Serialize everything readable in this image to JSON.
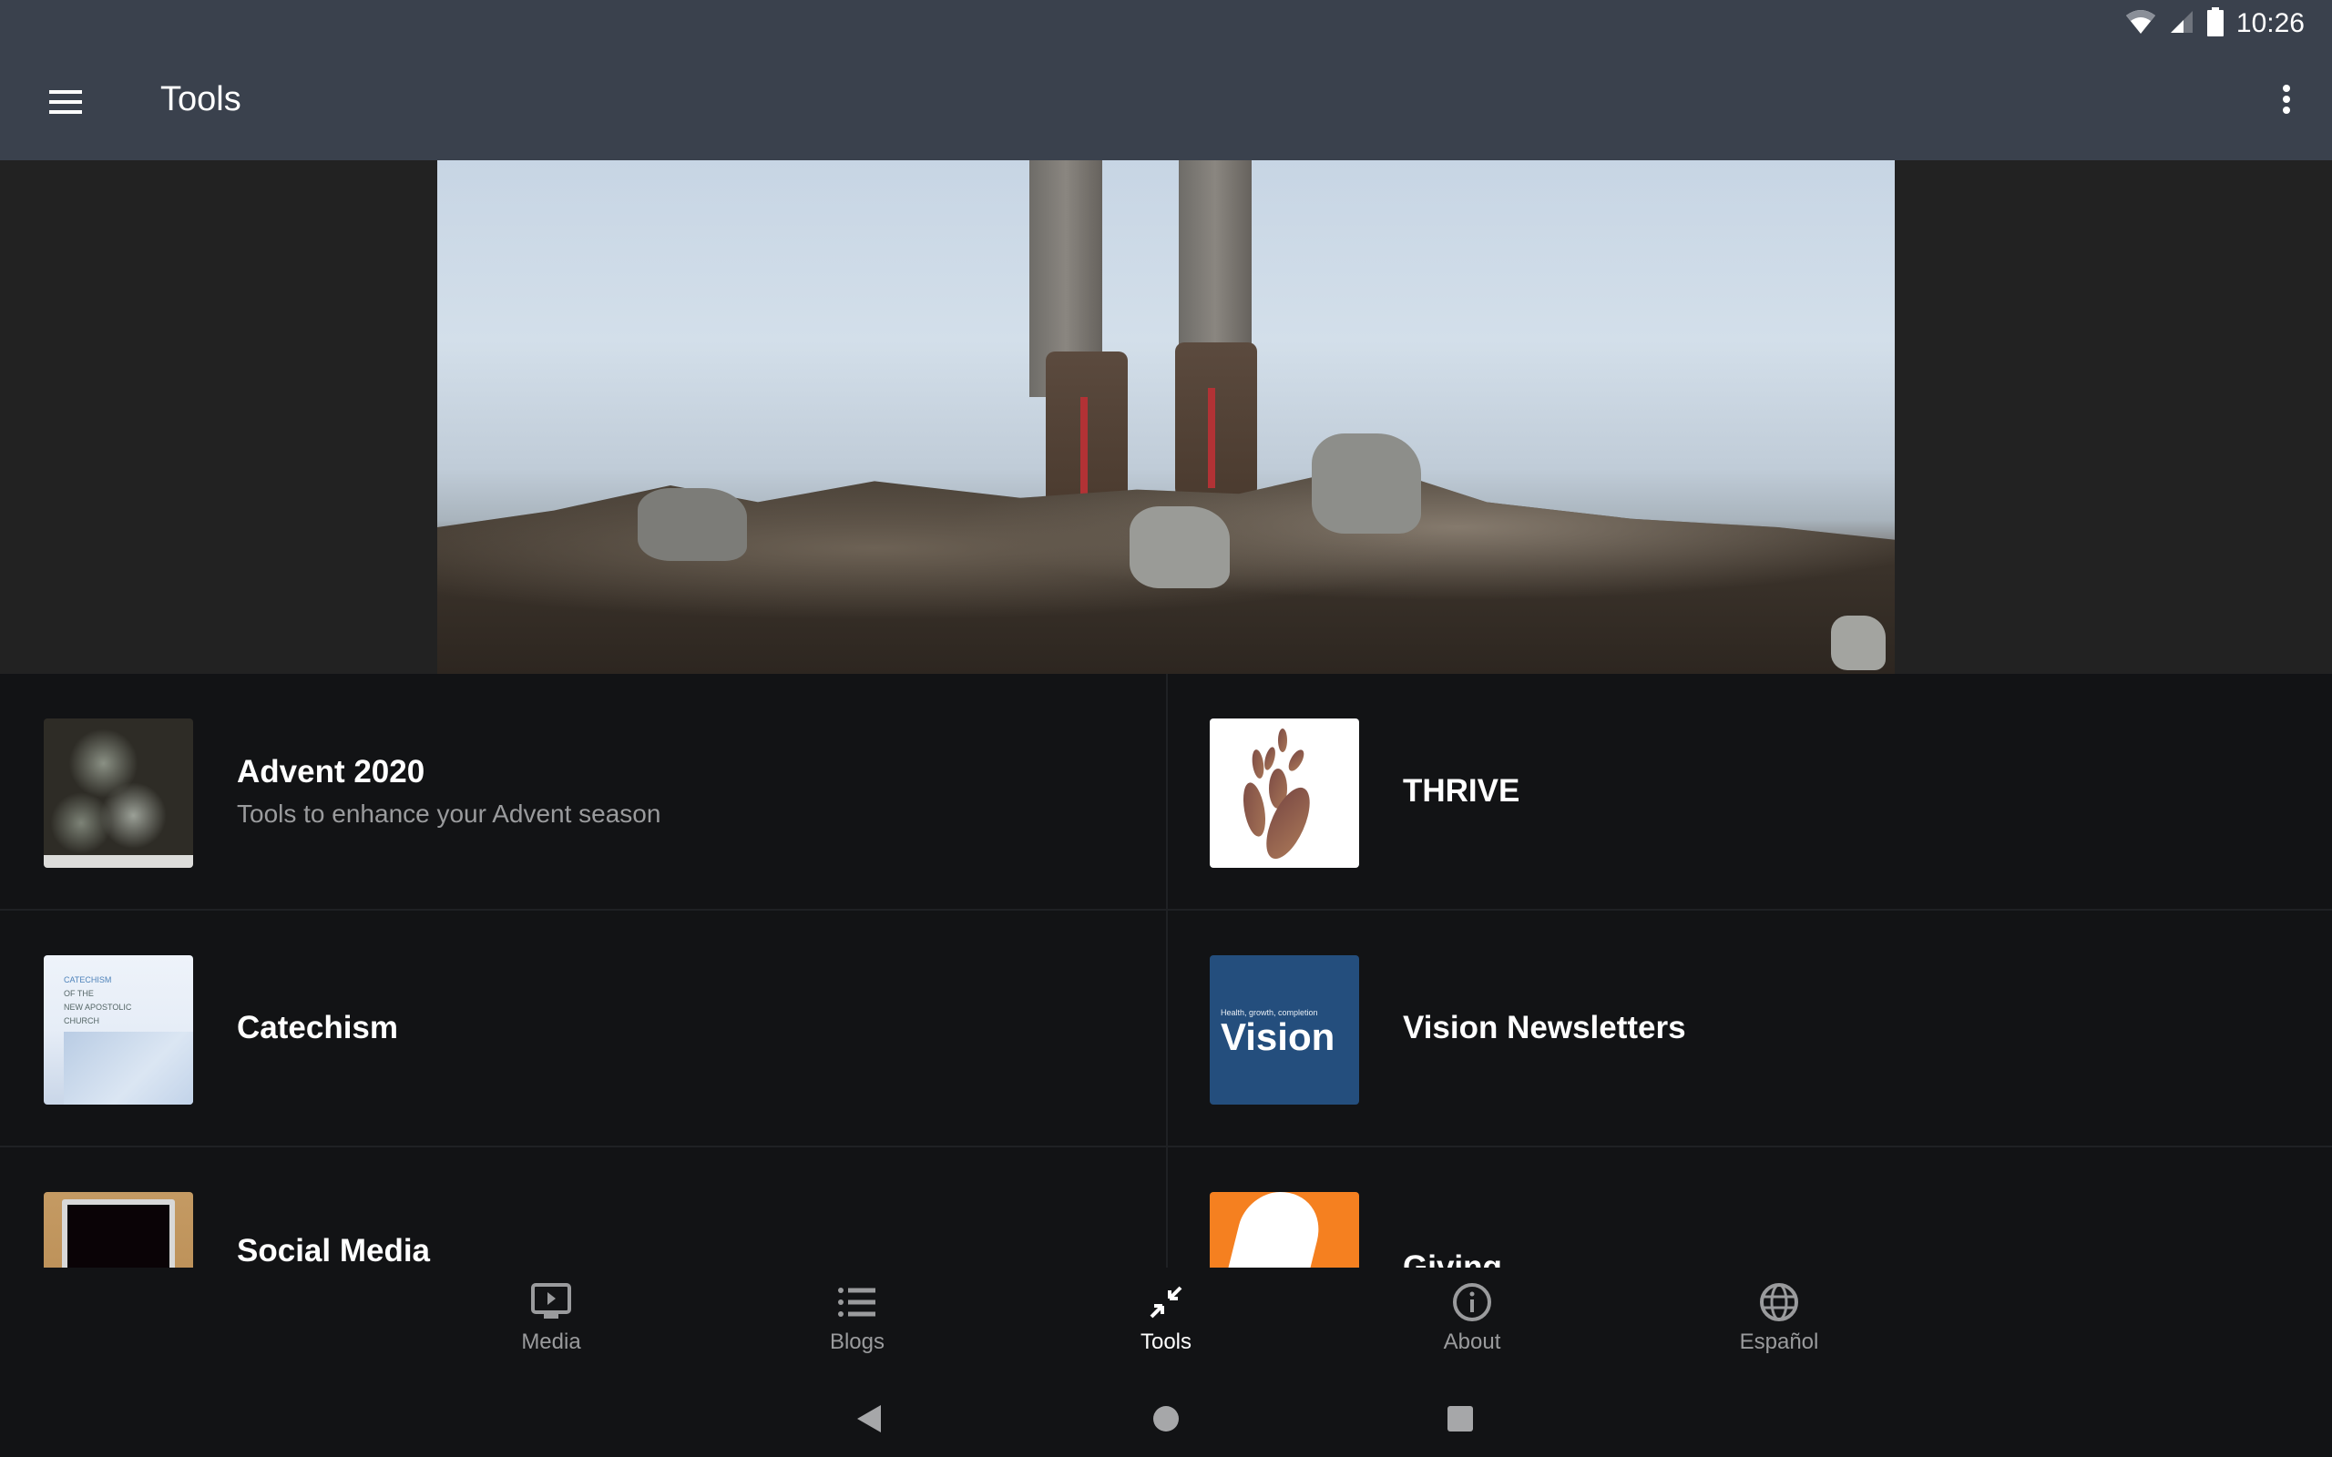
{
  "status_bar": {
    "time": "10:26",
    "icons": [
      "wifi-icon",
      "cell-signal-icon",
      "battery-icon"
    ]
  },
  "app_bar": {
    "title": "Tools",
    "menu_icon": "hamburger-menu-icon",
    "overflow_icon": "more-vert-icon"
  },
  "hero": {
    "description": "Hiking boots standing on rocky ground against misty sky"
  },
  "list": {
    "items": [
      {
        "title": "Advent 2020",
        "subtitle": "Tools to enhance your Advent season",
        "thumb": "advent-snowy-trees"
      },
      {
        "title": "THRIVE",
        "subtitle": "",
        "thumb": "thrive-leaf-logo"
      },
      {
        "title": "Catechism",
        "subtitle": "",
        "thumb": "catechism-book-cover",
        "thumb_text": [
          "CATECHISM",
          "OF THE",
          "NEW APOSTOLIC",
          "CHURCH"
        ]
      },
      {
        "title": "Vision Newsletters",
        "subtitle": "",
        "thumb": "vision-cover",
        "thumb_text": {
          "small": "Health, growth, completion",
          "big": "Vision"
        }
      },
      {
        "title": "Social Media",
        "subtitle": "",
        "thumb": "laptop-on-desk"
      },
      {
        "title": "Giving",
        "subtitle": "",
        "thumb": "giving-hand-orange"
      }
    ]
  },
  "bottom_nav": {
    "items": [
      {
        "label": "Media",
        "icon": "media-screen-icon",
        "active": false
      },
      {
        "label": "Blogs",
        "icon": "list-icon",
        "active": false
      },
      {
        "label": "Tools",
        "icon": "tools-compress-arrows-icon",
        "active": true
      },
      {
        "label": "About",
        "icon": "info-icon",
        "active": false
      },
      {
        "label": "Español",
        "icon": "globe-icon",
        "active": false
      }
    ]
  },
  "system_nav": {
    "buttons": [
      "back",
      "home",
      "recents"
    ]
  },
  "colors": {
    "app_bar": "#3a414d",
    "background": "#121315",
    "hero_side": "#222222",
    "text_primary": "#ffffff",
    "text_secondary": "#9a9b9d",
    "vision_blue": "#244e7d",
    "giving_orange": "#f58020"
  }
}
